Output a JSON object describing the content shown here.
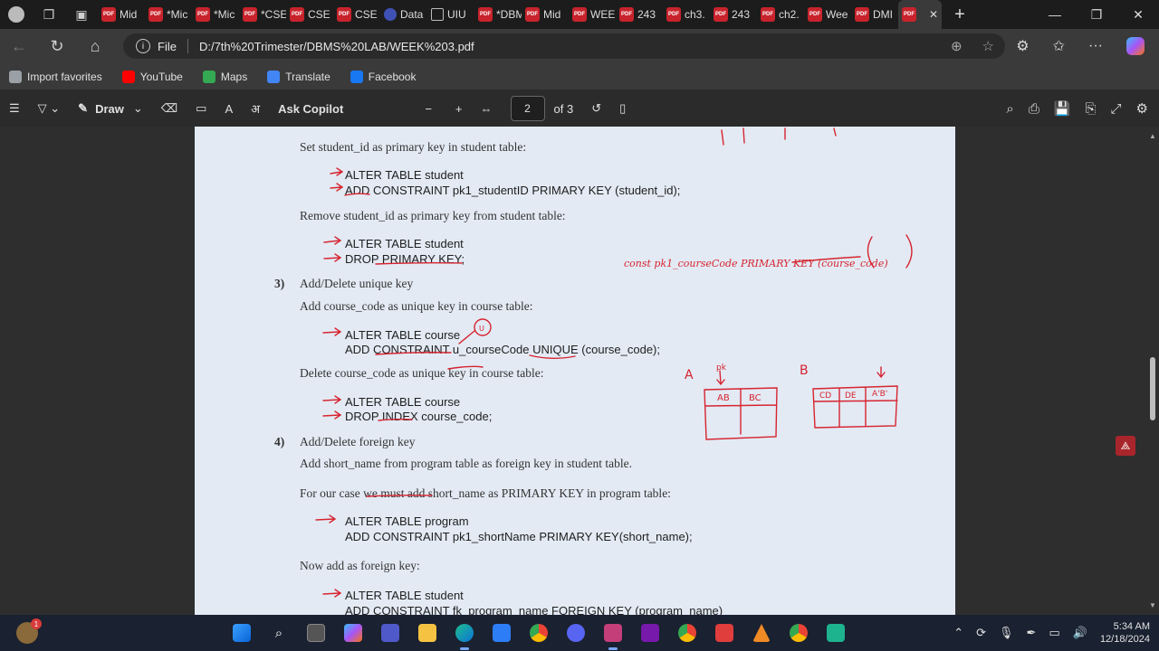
{
  "browser": {
    "tabs": [
      {
        "label": "Mid",
        "icon": "pdf-icon"
      },
      {
        "label": "*Mic",
        "icon": "pdf-icon"
      },
      {
        "label": "*Mic",
        "icon": "pdf-icon"
      },
      {
        "label": "*CSE",
        "icon": "pdf-icon"
      },
      {
        "label": "CSE",
        "icon": "pdf-icon"
      },
      {
        "label": "CSE",
        "icon": "pdf-icon"
      },
      {
        "label": "Data",
        "icon": "site-icon"
      },
      {
        "label": "UIU",
        "icon": "file-icon"
      },
      {
        "label": "*DBM",
        "icon": "pdf-icon"
      },
      {
        "label": "Mid",
        "icon": "pdf-icon"
      },
      {
        "label": "WEE",
        "icon": "pdf-icon"
      },
      {
        "label": "243",
        "icon": "pdf-icon"
      },
      {
        "label": "ch3.",
        "icon": "pdf-icon"
      },
      {
        "label": "243",
        "icon": "pdf-icon"
      },
      {
        "label": "ch2.",
        "icon": "pdf-icon"
      },
      {
        "label": "Wee",
        "icon": "pdf-icon"
      },
      {
        "label": "DMI",
        "icon": "pdf-icon"
      }
    ],
    "address": {
      "scheme_label": "File",
      "url": "D:/7th%20Trimester/DBMS%20LAB/WEEK%203.pdf"
    },
    "favorites": [
      {
        "label": "Import favorites",
        "color": "#9aa0a6"
      },
      {
        "label": "YouTube",
        "color": "#ff0000"
      },
      {
        "label": "Maps",
        "color": "#34a853"
      },
      {
        "label": "Translate",
        "color": "#4285f4"
      },
      {
        "label": "Facebook",
        "color": "#1877f2"
      }
    ]
  },
  "pdf_toolbar": {
    "draw_label": "Draw",
    "copilot_label": "Ask Copilot",
    "page_current": "2",
    "page_total": "of 3"
  },
  "document": {
    "lines": {
      "l0": "Set student_id as primary key in student table:",
      "c1": "ALTER TABLE student",
      "c2": "ADD CONSTRAINT pk1_studentID PRIMARY KEY (student_id);",
      "l1": "Remove student_id as primary key from student table:",
      "c3": "ALTER TABLE student",
      "c4": "DROP PRIMARY KEY;",
      "n3": "3)",
      "h3": "Add/Delete unique key",
      "l2": "Add course_code as unique key in course table:",
      "c5": "ALTER TABLE course",
      "c6": "ADD CONSTRAINT u_courseCode UNIQUE (course_code);",
      "l3": "Delete course_code as unique key in course table:",
      "c7": "ALTER TABLE course",
      "c8": "DROP INDEX course_code;",
      "n4": "4)",
      "h4": "Add/Delete foreign key",
      "l4": "Add short_name from program table as foreign key in student table.",
      "l5": "For our case we must add short_name as PRIMARY KEY in program table:",
      "c9": "ALTER TABLE program",
      "c10": "ADD CONSTRAINT pk1_shortName PRIMARY KEY(short_name);",
      "l6": "Now add as foreign key:",
      "c11": "ALTER TABLE student",
      "c12": "ADD CONSTRAINT fk_program_name FOREIGN KEY (program_name)"
    },
    "annotations": {
      "const_note": "const pk1_courseCode PRIMARY KEY (course_code)",
      "table_a": "A",
      "table_b": "B",
      "pk": "pk",
      "a_col1": "AB",
      "a_col2": "BC",
      "b_col1": "CD",
      "b_col2": "DE",
      "b_col3": "A'B'",
      "u_marker": "U",
      "ink_color": "#d6242f"
    }
  },
  "taskbar": {
    "time": "5:34 AM",
    "date": "12/18/2024",
    "weather_badge": "1"
  }
}
